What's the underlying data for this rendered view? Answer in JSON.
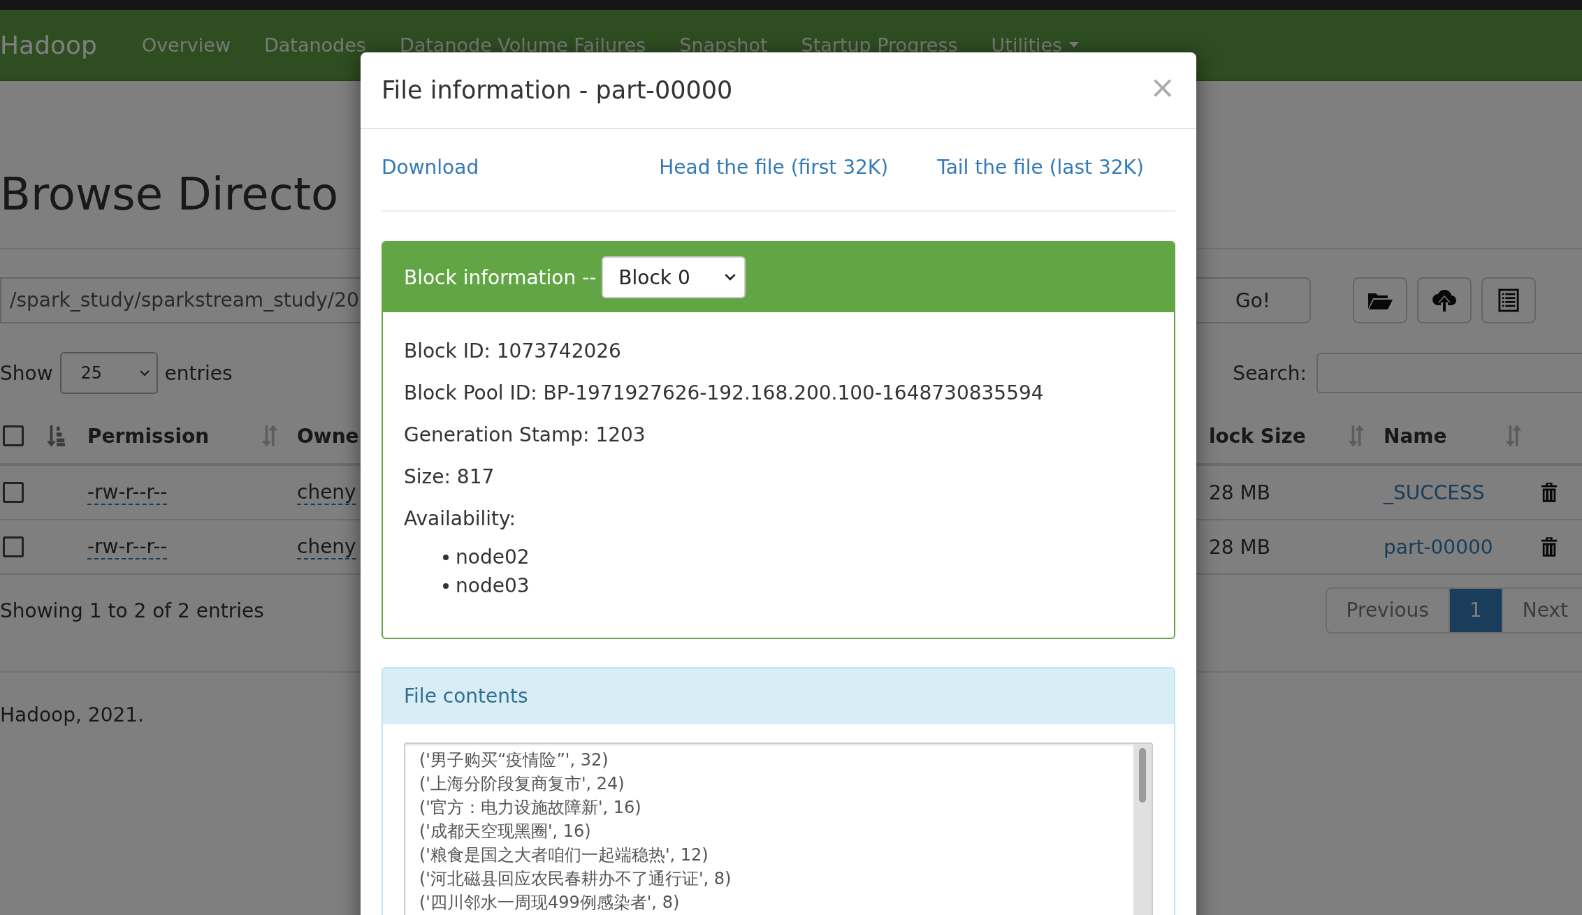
{
  "navbar": {
    "brand": "Hadoop",
    "items": [
      {
        "label": "Overview",
        "dropdown": false
      },
      {
        "label": "Datanodes",
        "dropdown": false
      },
      {
        "label": "Datanode Volume Failures",
        "dropdown": false
      },
      {
        "label": "Snapshot",
        "dropdown": false
      },
      {
        "label": "Startup Progress",
        "dropdown": false
      },
      {
        "label": "Utilities",
        "dropdown": true
      }
    ]
  },
  "page": {
    "heading": "Browse Directo",
    "path": "/spark_study/sparkstream_study/20",
    "go_button": "Go!",
    "length_menu": {
      "prefix": "Show",
      "value": "25",
      "suffix": "entries"
    },
    "search": {
      "label": "Search:"
    },
    "table": {
      "select_all": {
        "checked": false
      },
      "left_columns": [
        "Permission",
        "Owne"
      ],
      "right_columns": [
        "lock Size",
        "Name"
      ],
      "rows": [
        {
          "checked": false,
          "permission": "-rw-r--r--",
          "owner": "cheny",
          "block_size": "28 MB",
          "name": "_SUCCESS"
        },
        {
          "checked": false,
          "permission": "-rw-r--r--",
          "owner": "cheny",
          "block_size": "28 MB",
          "name": "part-00000"
        }
      ]
    },
    "info": "Showing 1 to 2 of 2 entries",
    "pagination": [
      {
        "label": "Previous",
        "selected": false
      },
      {
        "label": "1",
        "selected": true
      },
      {
        "label": "Next",
        "selected": false
      }
    ],
    "footer": "Hadoop, 2021."
  },
  "modal": {
    "title": "File information - part-00000",
    "close": "×",
    "links": [
      "Download",
      "Head the file (first 32K)",
      "Tail the file (last 32K)"
    ],
    "block_panel": {
      "title": "Block information --",
      "select": "Block 0",
      "fields": [
        "Block ID: 1073742026",
        "Block Pool ID: BP-1971927626-192.168.200.100-1648730835594",
        "Generation Stamp: 1203",
        "Size: 817"
      ],
      "availability_label": "Availability:",
      "nodes": [
        "node02",
        "node03"
      ]
    },
    "contents_panel": {
      "title": "File contents",
      "lines": [
        "('男子购买“疫情险”', 32)",
        "('上海分阶段复商复市', 24)",
        "('官方：电力设施故障新', 16)",
        "('成都天空现黑圈', 16)",
        "('粮食是国之大者咱们一起端稳热', 12)",
        "('河北磁县回应农民春耕办不了通行证', 8)",
        "('四川邻水一周现499例感染者', 8)"
      ]
    }
  }
}
